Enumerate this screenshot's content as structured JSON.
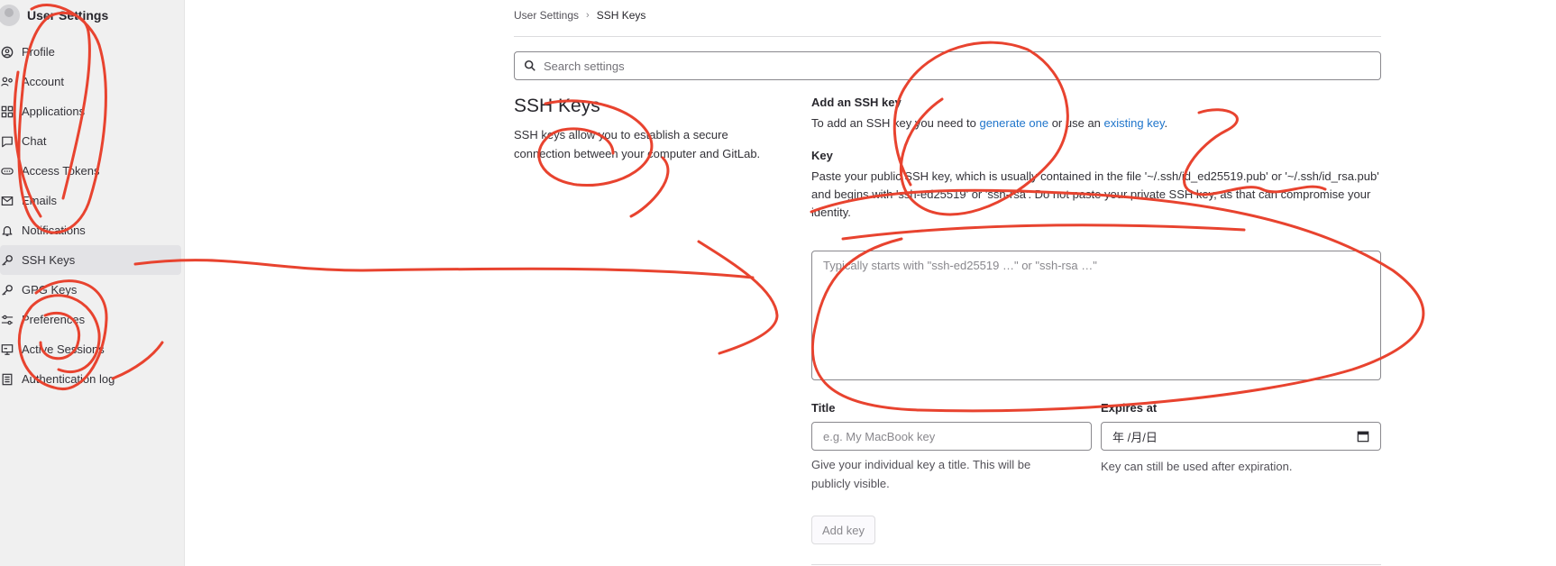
{
  "sidebar": {
    "title": "User Settings",
    "items": [
      {
        "label": "Profile",
        "icon": "profile-icon"
      },
      {
        "label": "Account",
        "icon": "account-icon"
      },
      {
        "label": "Applications",
        "icon": "applications-icon"
      },
      {
        "label": "Chat",
        "icon": "chat-icon"
      },
      {
        "label": "Access Tokens",
        "icon": "token-icon"
      },
      {
        "label": "Emails",
        "icon": "mail-icon"
      },
      {
        "label": "Notifications",
        "icon": "bell-icon"
      },
      {
        "label": "SSH Keys",
        "icon": "key-icon",
        "active": true
      },
      {
        "label": "GPG Keys",
        "icon": "key-icon"
      },
      {
        "label": "Preferences",
        "icon": "preferences-icon"
      },
      {
        "label": "Active Sessions",
        "icon": "monitor-icon"
      },
      {
        "label": "Authentication log",
        "icon": "log-icon"
      }
    ]
  },
  "breadcrumb": {
    "parent": "User Settings",
    "separator": "›",
    "current": "SSH Keys"
  },
  "search": {
    "placeholder": "Search settings"
  },
  "section": {
    "title": "SSH Keys",
    "description": "SSH keys allow you to establish a secure connection between your computer and GitLab."
  },
  "add_key": {
    "heading": "Add an SSH key",
    "intro_prefix": "To add an SSH key you need to ",
    "generate_link": "generate one",
    "intro_mid": " or use an ",
    "existing_link": "existing key",
    "intro_suffix": ".",
    "key_label": "Key",
    "key_help": "Paste your public SSH key, which is usually contained in the file '~/.ssh/id_ed25519.pub' or '~/.ssh/id_rsa.pub' and begins with 'ssh-ed25519' or 'ssh-rsa'. Do not paste your private SSH key, as that can compromise your identity.",
    "key_placeholder": "Typically starts with \"ssh-ed25519 …\" or \"ssh-rsa …\"",
    "title_label": "Title",
    "title_placeholder": "e.g. My MacBook key",
    "title_help": "Give your individual key a title. This will be publicly visible.",
    "expires_label": "Expires at",
    "expires_value": "年 /月/日",
    "expires_help": "Key can still be used after expiration.",
    "submit_label": "Add key"
  },
  "colors": {
    "annotation": "#e8432f",
    "link": "#1f75cb",
    "sidebar_bg": "#f0f0f0"
  }
}
